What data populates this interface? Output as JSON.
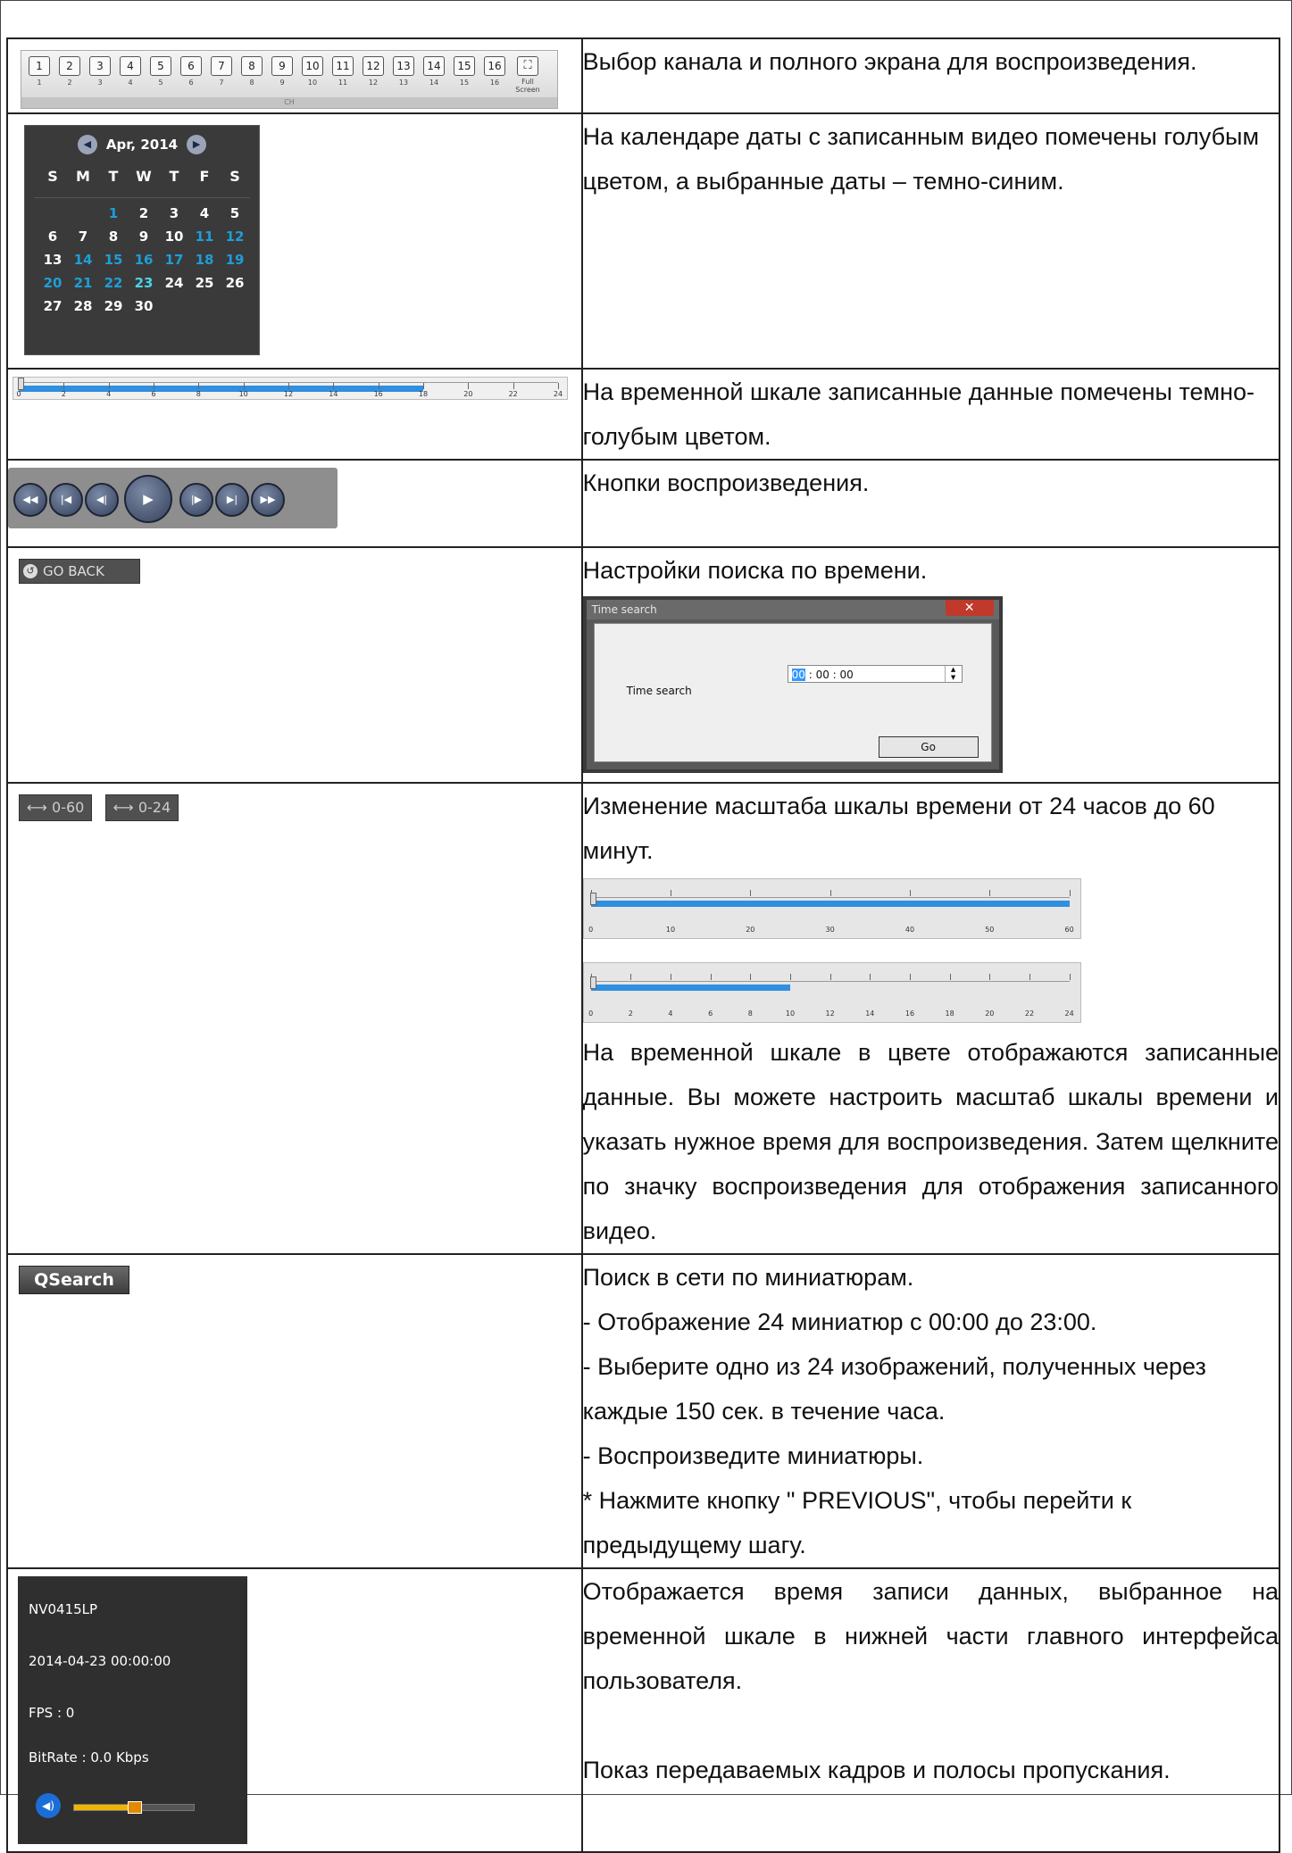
{
  "rows": {
    "channel": {
      "text": "Выбор канала и полного экрана для воспроизведения.",
      "buttons": [
        "1",
        "2",
        "3",
        "4",
        "5",
        "6",
        "7",
        "8",
        "9",
        "10",
        "11",
        "12",
        "13",
        "14",
        "15",
        "16"
      ],
      "full_screen_line1": "Full",
      "full_screen_line2": "Screen",
      "footer": "CH"
    },
    "calendar": {
      "text": "На календаре даты с записанным видео помечены голубым цветом, а выбранные даты – темно-синим.",
      "month": "Apr, 2014",
      "dows": [
        "S",
        "M",
        "T",
        "W",
        "T",
        "F",
        "S"
      ],
      "weeks": [
        [
          "",
          "",
          "1",
          "2",
          "3",
          "4",
          "5"
        ],
        [
          "6",
          "7",
          "8",
          "9",
          "10",
          "11",
          "12"
        ],
        [
          "13",
          "14",
          "15",
          "16",
          "17",
          "18",
          "19"
        ],
        [
          "20",
          "21",
          "22",
          "23",
          "24",
          "25",
          "26"
        ],
        [
          "27",
          "28",
          "29",
          "30",
          "",
          "",
          ""
        ]
      ],
      "recorded_days": [
        1,
        11,
        12,
        14,
        15,
        16,
        17,
        18,
        19,
        20,
        21,
        22
      ],
      "selected_day": 23
    },
    "timeline": {
      "text": "На временной шкале записанные данные помечены темно-голубым цветом.",
      "ticks": [
        "0",
        "2",
        "4",
        "6",
        "8",
        "10",
        "12",
        "14",
        "16",
        "18",
        "20",
        "22",
        "24"
      ],
      "recorded_to": 18
    },
    "playback": {
      "text": "Кнопки воспроизведения.",
      "buttons": [
        "fast-rewind-icon",
        "step-back-icon",
        "reverse-icon",
        "play-icon",
        "forward-frame-icon",
        "next-icon",
        "fast-forward-icon"
      ]
    },
    "timesearch": {
      "text": "Настройки поиска по времени.",
      "button_label": "GO BACK",
      "dialog_title": "Time search",
      "field_label": "Time search",
      "time_hh": "00",
      "time_rest": " : 00 : 00",
      "go_label": "Go"
    },
    "scale": {
      "text1": "Изменение масштаба шкалы времени от 24 часов до 60 минут.",
      "btn_60": "0-60",
      "btn_24": "0-24",
      "ticks60": [
        "0",
        "10",
        "20",
        "30",
        "40",
        "50",
        "60"
      ],
      "ticks24": [
        "0",
        "2",
        "4",
        "6",
        "8",
        "10",
        "12",
        "14",
        "16",
        "18",
        "20",
        "22",
        "24"
      ],
      "recorded24_to": 10,
      "text2": "На временной шкале в цвете отображаются записанные данные. Вы можете настроить масштаб шкалы времени и указать нужное время для воспроизведения. Затем щелкните по значку воспроизведения для отображения записанного видео."
    },
    "qsearch": {
      "button_label": "QSearch",
      "lines": [
        "Поиск в сети по миниатюрам.",
        "- Отображение 24 миниатюр с 00:00 до 23:00.",
        "- Выберите одно из 24 изображений, полученных через каждые 150 сек. в течение часа.",
        "- Воспроизведите миниатюры.",
        "* Нажмите кнопку \" PREVIOUS\", чтобы перейти к предыдущему шагу."
      ]
    },
    "info": {
      "device": "NV0415LP",
      "datetime": "2014-04-23 00:00:00",
      "fps": "FPS :  0",
      "bitrate": "BitRate :  0.0 Kbps",
      "volume_level": 0.5,
      "text1": "Отображается время записи данных, выбранное на временной шкале в нижней части главного интерфейса пользователя.",
      "text2": "Показ передаваемых кадров и полосы пропускания."
    }
  }
}
